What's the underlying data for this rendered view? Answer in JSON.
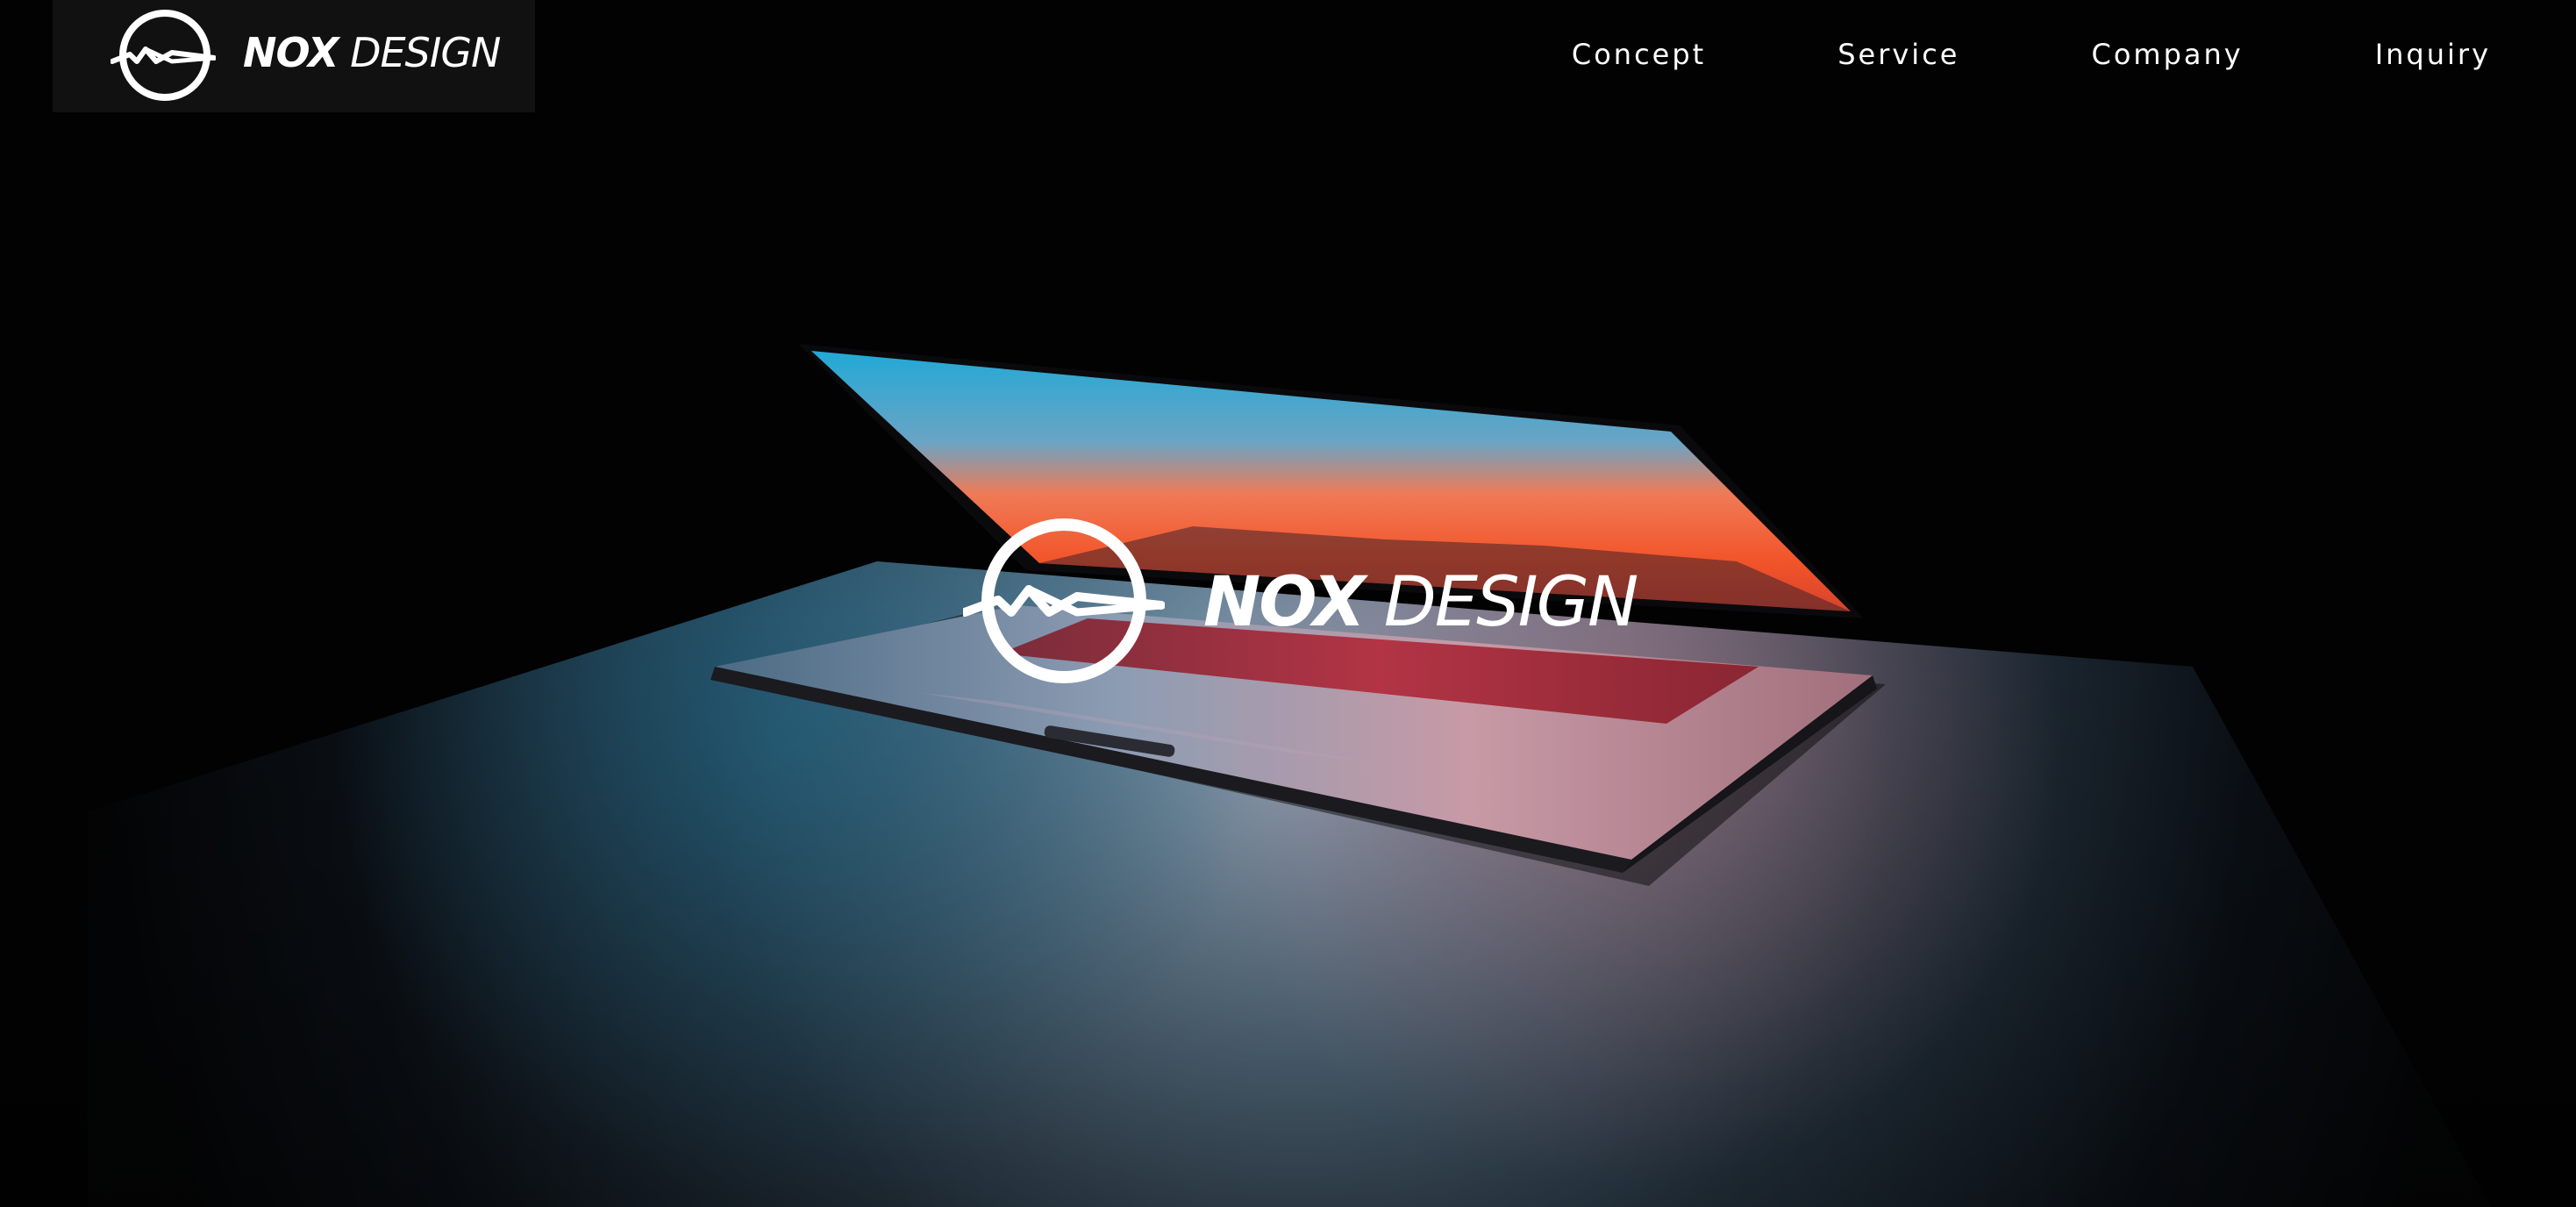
{
  "brand": {
    "name_bold": "NOX",
    "name_light": "DESIGN"
  },
  "nav": {
    "items": [
      "Concept",
      "Service",
      "Company",
      "Inquiry"
    ]
  },
  "hero": {
    "image": "laptop-glowing-in-dark"
  },
  "colors": {
    "background": "#000000",
    "text": "#ffffff",
    "logo_box": "#111111",
    "screen_blue": "#21a9d6",
    "screen_orange": "#f25a2b"
  }
}
